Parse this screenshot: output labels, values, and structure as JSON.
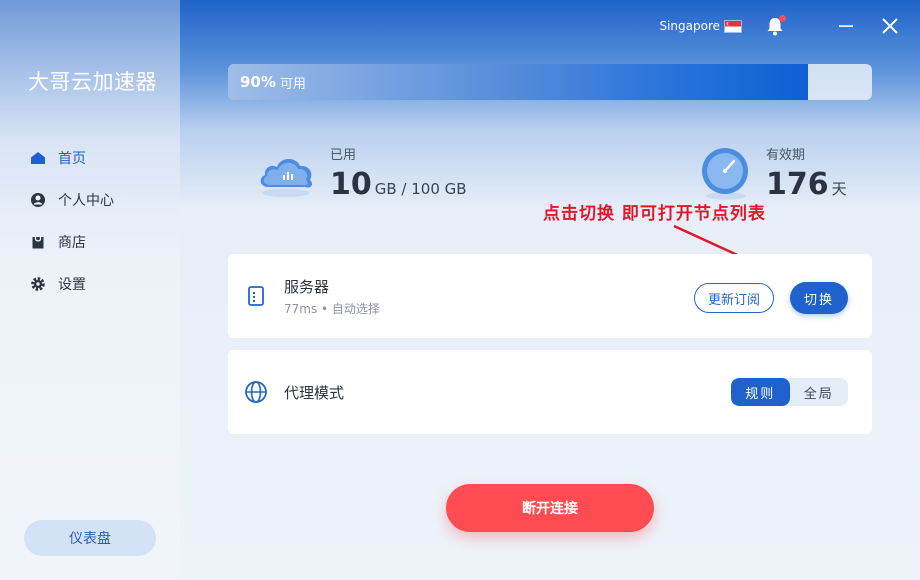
{
  "app": {
    "brand": "大哥云加速器"
  },
  "sidebar": {
    "items": [
      {
        "label": "首页",
        "icon": "home-icon",
        "active": true
      },
      {
        "label": "个人中心",
        "icon": "user-icon",
        "active": false
      },
      {
        "label": "商店",
        "icon": "shop-bag-icon",
        "active": false
      },
      {
        "label": "设置",
        "icon": "gear-icon",
        "active": false
      }
    ],
    "dashboard_button": "仪表盘"
  },
  "topbar": {
    "region": "Singapore",
    "region_flag": "singapore-flag-icon",
    "notification_badge": true
  },
  "usage": {
    "percent": 0.9,
    "percent_label": "90%",
    "available_label": "可用"
  },
  "stats": {
    "used": {
      "label": "已用",
      "value": "10",
      "unit": "GB / 100 GB"
    },
    "validity": {
      "label": "有效期",
      "value": "176",
      "unit": "天"
    }
  },
  "annotation": {
    "text": "点击切换  即可打开节点列表",
    "color": "#e0182a"
  },
  "server_card": {
    "title": "服务器",
    "subtitle": "77ms • 自动选择",
    "renew_label": "更新订阅",
    "switch_label": "切换"
  },
  "proxy_card": {
    "title": "代理模式",
    "options": [
      "规则",
      "全局"
    ],
    "selected": "规则"
  },
  "disconnect_label": "断开连接",
  "colors": {
    "accent": "#1f62cc",
    "danger": "#ff4c52",
    "annotation": "#e0182a"
  }
}
